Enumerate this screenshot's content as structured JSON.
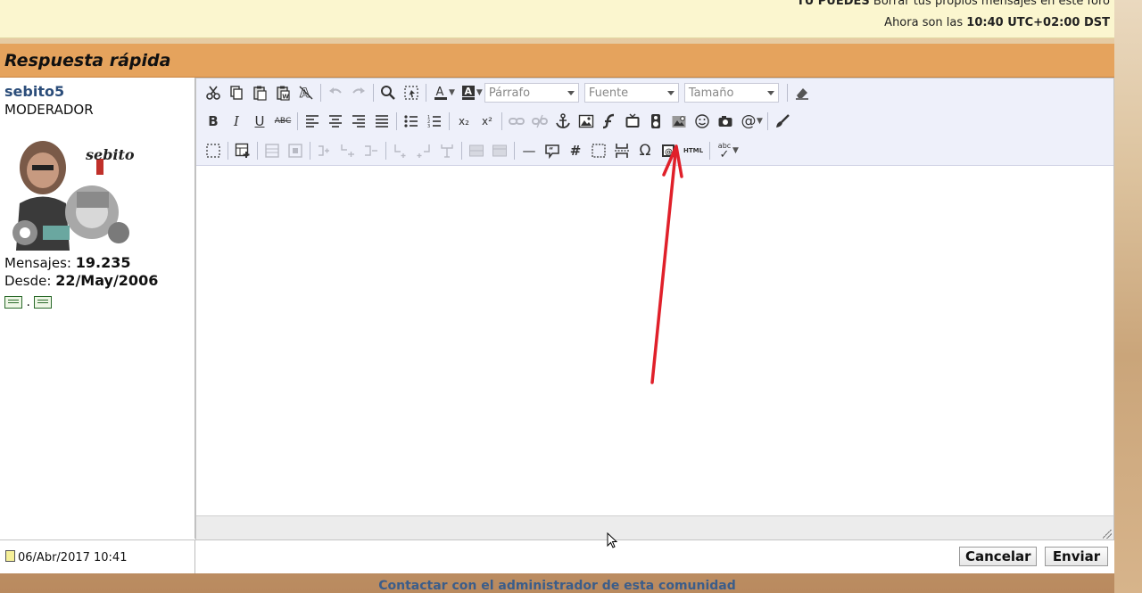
{
  "info": {
    "line1_bold": "TU PUEDES",
    "line1_rest": "Borrar tus propios mensajes en este foro",
    "line2_prefix": "Ahora son las",
    "line2_time": "10:40 UTC+02:00 DST"
  },
  "panel": {
    "title": "Respuesta rápida"
  },
  "user": {
    "name": "sebito5",
    "rank": "MODERADOR",
    "avatar_text": "sebito",
    "posts_label": "Mensajes:",
    "posts_value": "19.235",
    "since_label": "Desde:",
    "since_value": "22/May/2006",
    "icons_sep": "."
  },
  "toolbar": {
    "format_placeholder": "Párrafo",
    "font_placeholder": "Fuente",
    "size_placeholder": "Tamaño",
    "bold": "B",
    "italic": "I",
    "underline": "U",
    "strike": "ABC",
    "subscript": "x₂",
    "superscript": "x²",
    "hr": "—",
    "hash": "#",
    "omega": "Ω",
    "html": "HTML",
    "spell": "abc",
    "at": "@"
  },
  "footer": {
    "date": "06/Abr/2017 10:41",
    "cancel": "Cancelar",
    "send": "Enviar",
    "contact": "Contactar con el administrador de esta comunidad"
  },
  "colors": {
    "title_bg": "#e5a35d",
    "toolbar_bg": "#eef0fa",
    "user_name": "#2b4d7a",
    "annotation": "#e0202a"
  }
}
